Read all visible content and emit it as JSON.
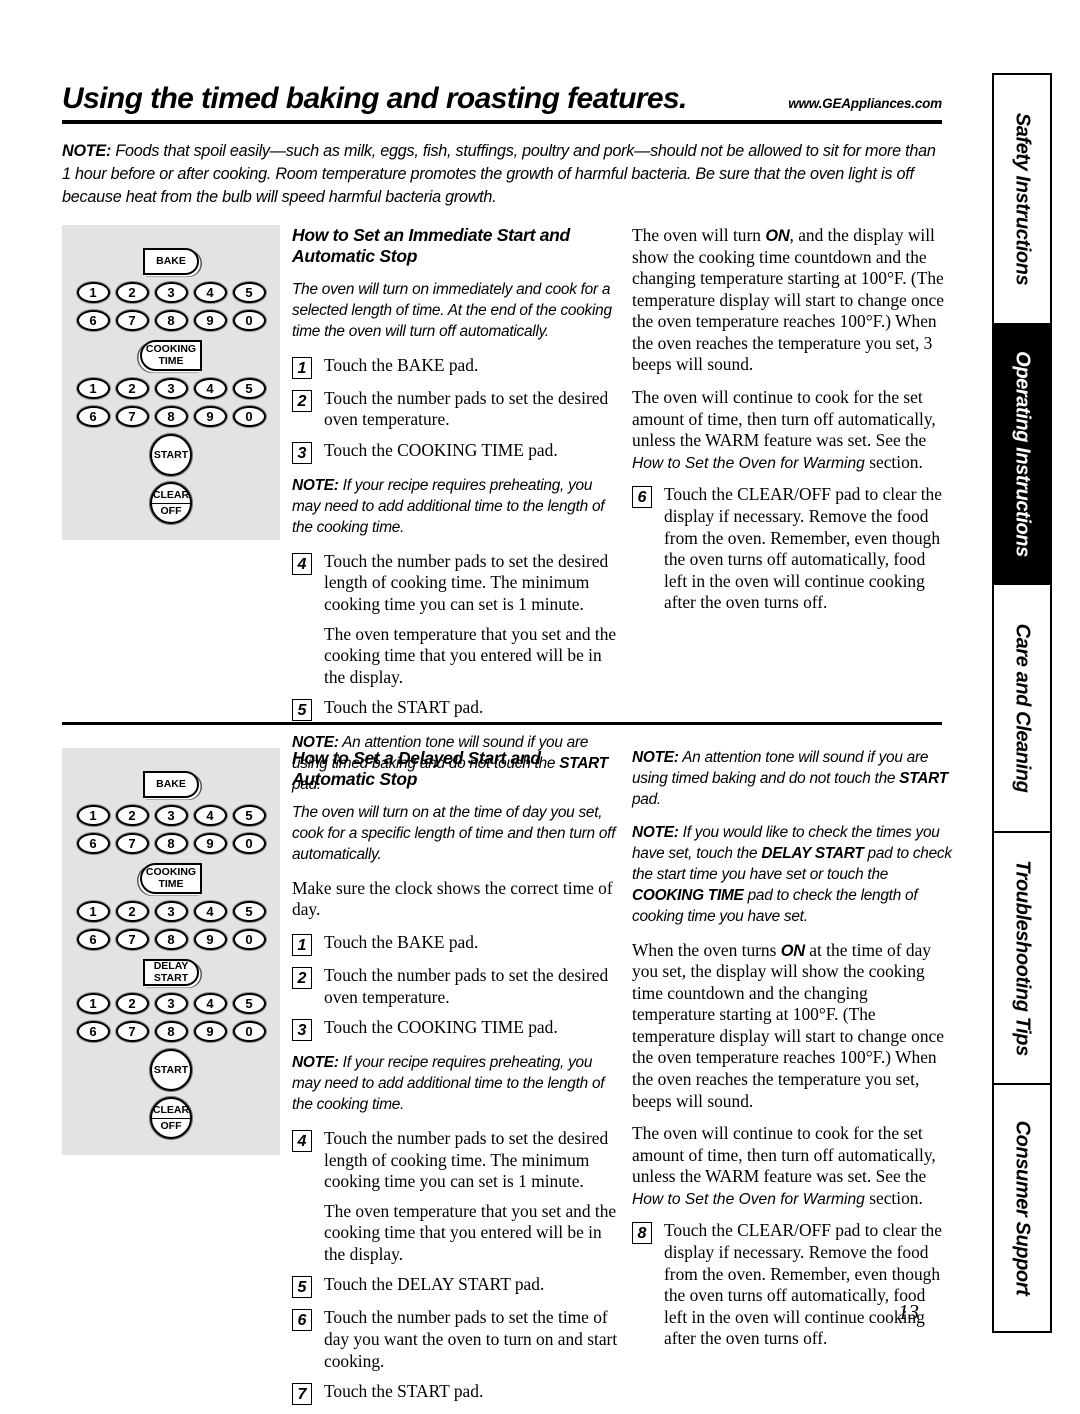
{
  "header": {
    "title": "Using the timed baking and roasting features.",
    "url": "www.GEAppliances.com"
  },
  "intro_note": {
    "label": "NOTE:",
    "text": "  Foods that spoil easily—such as milk, eggs, fish, stuffings, poultry and pork—should not be allowed to sit for more than 1 hour before or after cooking. Room temperature promotes the growth of harmful bacteria. Be sure that the oven light is off because heat from the bulb will speed harmful bacteria growth."
  },
  "section1": {
    "heading": "How to Set an Immediate Start and Automatic Stop",
    "intro": "The oven will turn on immediately and cook for a selected length of time. At the end of the cooking time the oven will turn off automatically.",
    "steps": [
      {
        "num": "1",
        "pre": "Touch the ",
        "bold": "BAKE",
        "post": " pad."
      },
      {
        "num": "2",
        "pre": "Touch the number pads to set the desired oven temperature.",
        "bold": "",
        "post": ""
      },
      {
        "num": "3",
        "pre": "Touch the ",
        "bold": "COOKING TIME",
        "post": " pad."
      },
      {
        "num": "4",
        "pre": "Touch the number pads to set the desired length of cooking time. The minimum cooking time you can set is 1 minute.",
        "bold": "",
        "post": ""
      },
      {
        "num": "5",
        "pre": "Touch the ",
        "bold": "START",
        "post": " pad."
      }
    ],
    "step4_extra": "The oven temperature that you set and the cooking time that you entered will be in the display.",
    "note_preheat": {
      "label": "NOTE:",
      "text": " If your recipe requires preheating, you may need to add additional time to the length of the cooking time."
    },
    "note_tone": {
      "label": "NOTE:",
      "text_a": " An attention tone will sound if you are using timed baking and do not touch the ",
      "bold": "START",
      "text_b": " pad."
    },
    "right_p1_a": "The oven will turn ",
    "right_p1_on": "ON",
    "right_p1_b": ", and the display will show the cooking time countdown and the changing temperature starting at 100°F. (The temperature display will start to change once the oven temperature reaches 100°F.) When the oven reaches the temperature you set, 3 beeps will sound.",
    "right_p2_a": "The oven will continue to cook for the set amount of time, then turn off automatically, unless the WARM feature was set. See the ",
    "right_p2_italic": "How to Set the Oven for Warming",
    "right_p2_b": " section.",
    "step6": {
      "num": "6",
      "pre": "Touch the ",
      "bold": "CLEAR/OFF",
      "post": " pad to clear the display if necessary. Remove the food from the oven. Remember, even though the oven turns off automatically, food left in the oven will continue cooking after the oven turns off."
    }
  },
  "section2": {
    "heading": "How to Set a Delayed Start and Automatic Stop",
    "intro": "The oven will turn on at the time of day you set, cook for a specific length of time and then turn off automatically.",
    "clock_note": "Make sure the clock shows the correct time of day.",
    "steps": [
      {
        "num": "1",
        "pre": "Touch the ",
        "bold": "BAKE",
        "post": " pad."
      },
      {
        "num": "2",
        "pre": "Touch the number pads to set the desired oven temperature.",
        "bold": "",
        "post": ""
      },
      {
        "num": "3",
        "pre": "Touch the ",
        "bold": "COOKING TIME",
        "post": " pad."
      },
      {
        "num": "4",
        "pre": "Touch the number pads to set the desired length of cooking time. The minimum cooking time you can set is 1 minute.",
        "bold": "",
        "post": ""
      },
      {
        "num": "5",
        "pre": "Touch the ",
        "bold": "DELAY START",
        "post": " pad."
      },
      {
        "num": "6",
        "pre": "Touch the number pads to set the time of day you want the oven to turn on and start cooking.",
        "bold": "",
        "post": ""
      },
      {
        "num": "7",
        "pre": "Touch the ",
        "bold": "START",
        "post": " pad."
      }
    ],
    "step4_extra": "The oven temperature that you set and the cooking time that you entered will be in the display.",
    "note_preheat": {
      "label": "NOTE:",
      "text": " If your recipe requires preheating, you may need to add additional time to the length of the cooking time."
    },
    "note_tone": {
      "label": "NOTE:",
      "text_a": " An attention tone will sound if you are using timed baking and do not touch the ",
      "bold": "START",
      "text_b": " pad."
    },
    "note_check": {
      "label": "NOTE:",
      "text_a": " If you would like to check the times you have set, touch the ",
      "bold_a": "DELAY START",
      "text_b": " pad to check the start time you have set or touch the ",
      "bold_b": "COOKING TIME",
      "text_c": " pad to check the length of cooking time you have set."
    },
    "right_p1_a": "When the oven turns ",
    "right_p1_on": "ON",
    "right_p1_b": " at the time of day you set, the display will show the cooking time countdown and the changing temperature starting at 100°F. (The temperature display will start to change once the oven temperature reaches 100°F.) When the oven reaches the temperature you set, beeps will sound.",
    "right_p2_a": "The oven will continue to cook for the set amount of time, then turn off automatically, unless the WARM feature was set. See the ",
    "right_p2_italic": "How to Set the Oven for Warming",
    "right_p2_b": " section.",
    "step8": {
      "num": "8",
      "pre": "Touch the ",
      "bold": "CLEAR/OFF",
      "post": " pad to clear the display if necessary. Remove the food from the oven. Remember, even though the oven turns off automatically, food left in the oven will continue cooking after the oven turns off."
    }
  },
  "control_panel_1": {
    "pads": [
      "BAKE",
      "COOKING TIME",
      "START",
      "CLEAR",
      "OFF"
    ],
    "number_rows": [
      [
        "1",
        "2",
        "3",
        "4",
        "5"
      ],
      [
        "6",
        "7",
        "8",
        "9",
        "0"
      ]
    ]
  },
  "control_panel_2": {
    "pads": [
      "BAKE",
      "COOKING TIME",
      "DELAY START",
      "START",
      "CLEAR",
      "OFF"
    ],
    "number_rows": [
      [
        "1",
        "2",
        "3",
        "4",
        "5"
      ],
      [
        "6",
        "7",
        "8",
        "9",
        "0"
      ]
    ]
  },
  "sidebar": {
    "tabs": [
      {
        "label": "Safety Instructions",
        "active": false
      },
      {
        "label": "Operating Instructions",
        "active": true
      },
      {
        "label": "Care and Cleaning",
        "active": false
      },
      {
        "label": "Troubleshooting Tips",
        "active": false
      },
      {
        "label": "Consumer Support",
        "active": false
      }
    ]
  },
  "page_number": "13"
}
